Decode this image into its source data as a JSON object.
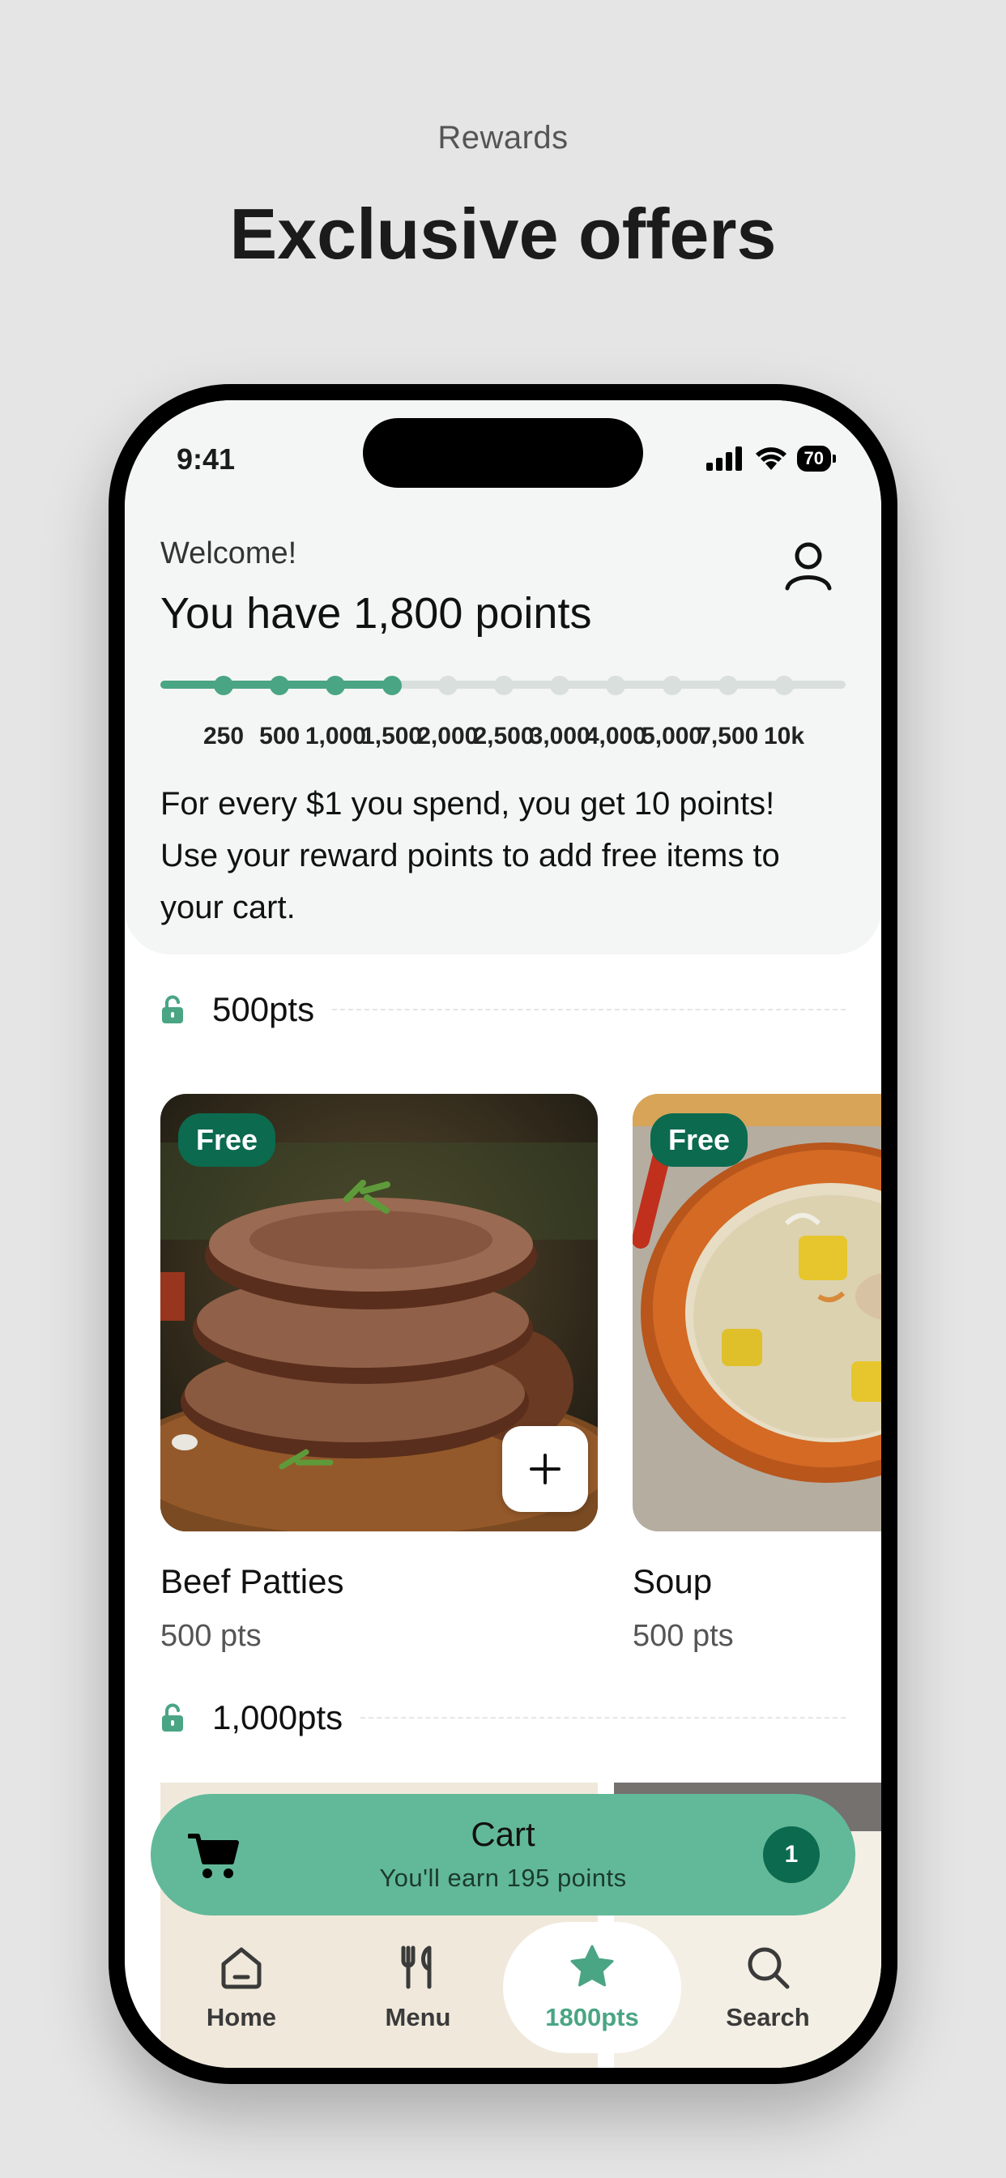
{
  "page": {
    "eyebrow": "Rewards",
    "headline": "Exclusive offers"
  },
  "status_bar": {
    "time": "9:41",
    "battery": "70"
  },
  "header": {
    "welcome": "Welcome!",
    "points_title": "You have 1,800 points",
    "profile_icon": "user-icon"
  },
  "progress": {
    "current_points": 1800,
    "milestones": [
      "250",
      "500",
      "1,000",
      "1,500",
      "2,000",
      "2,500",
      "3,000",
      "4,000",
      "5,000",
      "7,500",
      "10k"
    ],
    "reached_count": 4,
    "accent": "#4aa584"
  },
  "info_text": "For every $1 you spend, you get 10 points! Use your reward points to add free items to your cart.",
  "sections": [
    {
      "label": "500pts",
      "icon": "unlock-icon",
      "items": [
        {
          "badge": "Free",
          "name": "Beef Patties",
          "points": "500 pts",
          "image": "beef-patties"
        },
        {
          "badge": "Free",
          "name": "Soup",
          "points": "500 pts",
          "image": "soup"
        }
      ]
    },
    {
      "label": "1,000pts",
      "icon": "unlock-icon",
      "items": []
    }
  ],
  "cart": {
    "title": "Cart",
    "subtitle": "You'll earn 195 points",
    "count": "1",
    "icon": "cart-icon",
    "color": "#62b99a"
  },
  "tabs": [
    {
      "label": "Home",
      "icon": "home-icon",
      "active": false
    },
    {
      "label": "Menu",
      "icon": "utensils-icon",
      "active": false
    },
    {
      "label": "1800pts",
      "icon": "star-icon",
      "active": true
    },
    {
      "label": "Search",
      "icon": "search-icon",
      "active": false
    }
  ]
}
